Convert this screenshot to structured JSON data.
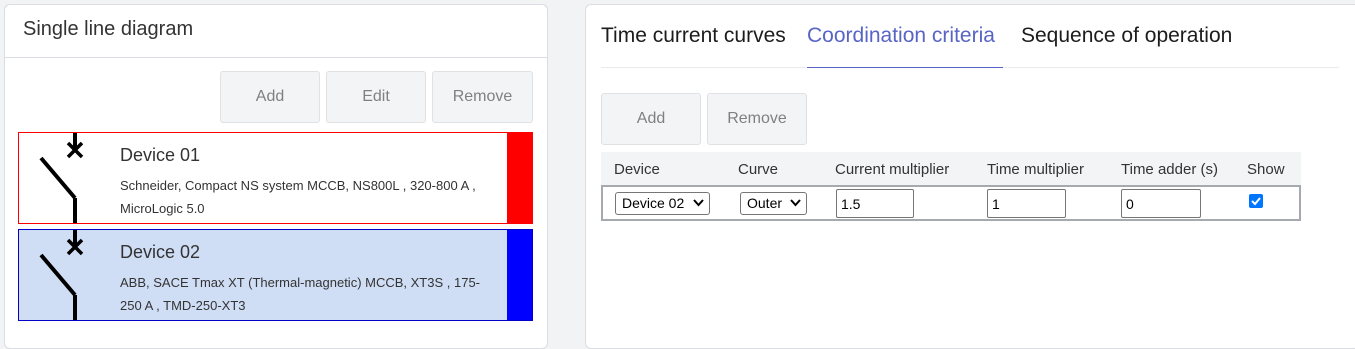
{
  "left_panel": {
    "title": "Single line diagram",
    "buttons": {
      "add": "Add",
      "edit": "Edit",
      "remove": "Remove"
    },
    "devices": [
      {
        "name": "Device 01",
        "description": "Schneider, Compact NS system MCCB, NS800L , 320-800 A , MicroLogic 5.0",
        "color": "#ff0000",
        "background": "#ffffff"
      },
      {
        "name": "Device 02",
        "description": "ABB, SACE Tmax XT (Thermal-magnetic) MCCB, XT3S , 175-250 A , TMD-250-XT3",
        "color": "#0000ff",
        "background": "#d0def5"
      }
    ]
  },
  "right_panel": {
    "tabs": [
      "Time current curves",
      "Coordination criteria",
      "Sequence of operation"
    ],
    "active_tab": "Coordination criteria",
    "buttons": {
      "add": "Add",
      "remove": "Remove"
    },
    "table": {
      "columns": [
        "Device",
        "Curve",
        "Current multiplier",
        "Time multiplier",
        "Time adder (s)",
        "Show"
      ],
      "rows": [
        {
          "device": "Device 02",
          "curve": "Outer",
          "current_multiplier": "1.5",
          "time_multiplier": "1",
          "time_adder": "0",
          "show": true
        }
      ]
    }
  },
  "colors": {
    "accent": "#5865c5",
    "checkbox": "#0075ff"
  }
}
